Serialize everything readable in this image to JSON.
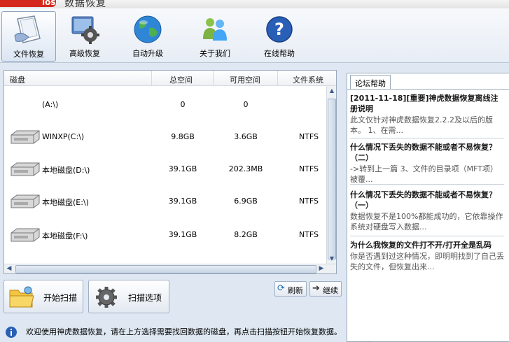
{
  "window": {
    "title": "数据恢复",
    "logo_text": "ios"
  },
  "toolbar": {
    "items": [
      {
        "label": "文件恢复",
        "icon": "document-restore-icon",
        "active": true
      },
      {
        "label": "高级恢复",
        "icon": "gear-monitor-icon",
        "active": false
      },
      {
        "label": "自动升级",
        "icon": "globe-icon",
        "active": false
      },
      {
        "label": "关于我们",
        "icon": "people-icon",
        "active": false
      },
      {
        "label": "在线帮助",
        "icon": "help-icon",
        "active": false
      }
    ]
  },
  "drives": {
    "headers": {
      "disk": "磁盘",
      "total": "总空间",
      "free": "可用空间",
      "fs": "文件系统"
    },
    "rows": [
      {
        "name": "(A:\\)",
        "total": "0",
        "free": "0",
        "fs": "",
        "icon": ""
      },
      {
        "name": "WINXP(C:\\)",
        "total": "9.8GB",
        "free": "3.6GB",
        "fs": "NTFS",
        "icon": "hard-drive-icon"
      },
      {
        "name": "本地磁盘(D:\\)",
        "total": "39.1GB",
        "free": "202.3MB",
        "fs": "NTFS",
        "icon": "hard-drive-icon"
      },
      {
        "name": "本地磁盘(E:\\)",
        "total": "39.1GB",
        "free": "6.9GB",
        "fs": "NTFS",
        "icon": "hard-drive-icon"
      },
      {
        "name": "本地磁盘(F:\\)",
        "total": "39.1GB",
        "free": "8.2GB",
        "fs": "NTFS",
        "icon": "hard-drive-icon"
      }
    ]
  },
  "actions": {
    "start_scan": "开始扫描",
    "scan_options": "扫描选项",
    "refresh": "刷新",
    "continue": "继续"
  },
  "forum": {
    "tab": "论坛帮助",
    "items": [
      {
        "title": "[2011-11-18][重要]神虎数据恢复离线注册说明",
        "body": "此文仅针对神虎数据恢复2.2.2及以后的版本。 1、在需..."
      },
      {
        "title": "什么情况下丢失的数据不能或者不易恢复？（二）",
        "body": "->转到上一篇 3、文件的目录项（MFT项）被覆..."
      },
      {
        "title": "什么情况下丢失的数据不能或者不易恢复？（一）",
        "body": "数据恢复不是100%都能成功的，它依靠操作系统对硬盘写入数据..."
      },
      {
        "title": "为什么我恢复的文件打不开/打开全是乱码",
        "body": "你是否遇到过这种情况，即明明找到了自己丢失的文件，但恢复出来..."
      }
    ],
    "cut_off": "……"
  },
  "status": {
    "text": "欢迎使用神虎数据恢复，请在上方选择需要找回数据的磁盘，再点击扫描按钮开始恢复数据。"
  }
}
